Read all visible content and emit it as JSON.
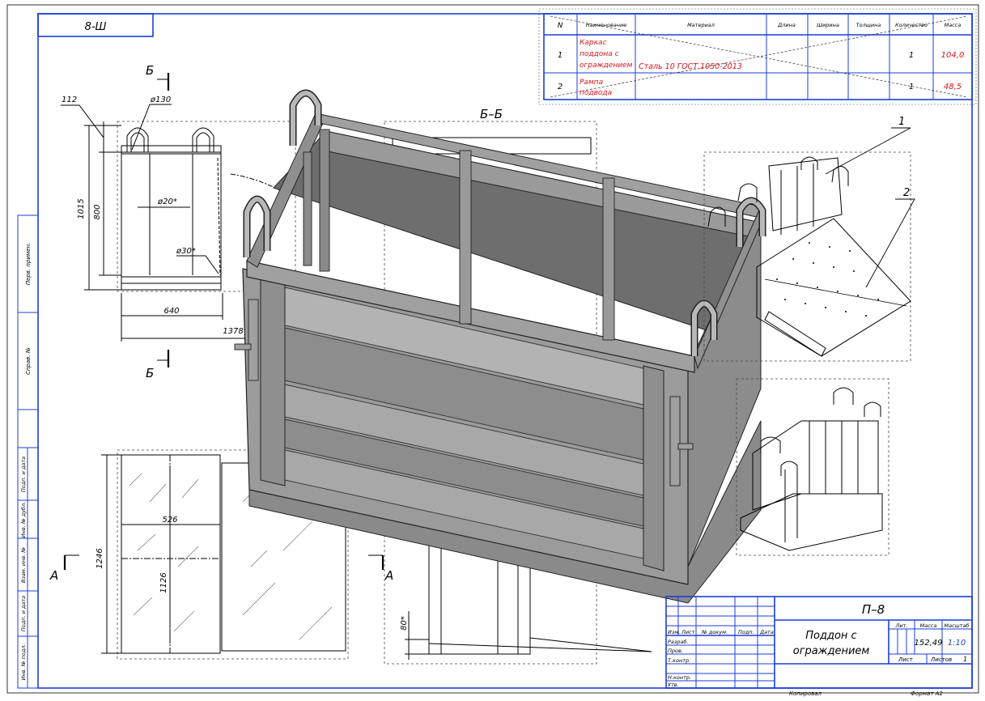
{
  "stamp_top": "8-Ш",
  "spec": {
    "headers": [
      "N",
      "Наименование",
      "Материал",
      "Длина",
      "Ширина",
      "Толщина",
      "Количество",
      "Масса"
    ],
    "rows": [
      {
        "n": "1",
        "name_lines": [
          "Каркас",
          "поддона с",
          "ограждением"
        ],
        "material": "Сталь 10  ГОСТ 1050-2013",
        "qty": "1",
        "mass": "104,0"
      },
      {
        "n": "2",
        "name_lines": [
          "Рампа",
          "подвода"
        ],
        "material": "",
        "qty": "1",
        "mass": "48,5"
      }
    ]
  },
  "sections": {
    "b": "Б",
    "bb": "Б–Б",
    "a": "А"
  },
  "dims": {
    "d112": "112",
    "d130": "ø130",
    "d1015": "1015",
    "d800": "800",
    "d20": "ø20*",
    "d30": "ø30*",
    "d640": "640",
    "d1378": "1378",
    "d1246": "1246",
    "d1126": "1126",
    "d526": "526",
    "d80": "80*"
  },
  "callouts": [
    "1",
    "2"
  ],
  "side_labels": [
    "Перв. примен.",
    "Справ. №",
    "Подп. и дата",
    "Инв. № дубл.",
    "Взам. инв. №",
    "Подп. и дата",
    "Инв. № подл."
  ],
  "title_block": {
    "designation": "П–8",
    "title_lines": [
      "Поддон с",
      "ограждением"
    ],
    "lit_label": "Лит.",
    "mass_label": "Масса",
    "scale_label": "Масштаб",
    "mass": "152,49",
    "scale": "1:10",
    "sheet_label": "Лист",
    "sheets_label": "Листов",
    "sheets": "1",
    "header_cells": [
      "Изм.",
      "Лист",
      "№ докум.",
      "Подп.",
      "Дата"
    ],
    "role_rows": [
      "Разраб.",
      "Пров.",
      "Т.контр.",
      "",
      "Н.контр.",
      "Утв."
    ],
    "copied": "Копировал",
    "format": "Формат   А2"
  },
  "colors": {
    "frame": "#1a3fd6",
    "accent": "#e0141c",
    "body": "#8a8a8a"
  }
}
